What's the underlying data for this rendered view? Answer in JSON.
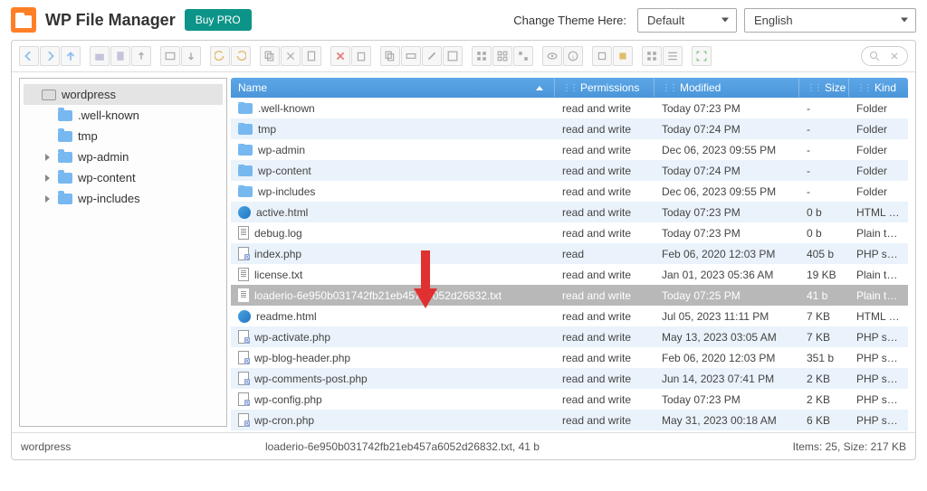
{
  "header": {
    "title": "WP File Manager",
    "buy_pro": "Buy PRO",
    "theme_label": "Change Theme Here:",
    "theme_value": "Default",
    "lang_value": "English"
  },
  "tree": {
    "root": "wordpress",
    "items": [
      {
        "label": ".well-known",
        "expandable": false
      },
      {
        "label": "tmp",
        "expandable": false
      },
      {
        "label": "wp-admin",
        "expandable": true
      },
      {
        "label": "wp-content",
        "expandable": true
      },
      {
        "label": "wp-includes",
        "expandable": true
      }
    ]
  },
  "columns": {
    "name": "Name",
    "permissions": "Permissions",
    "modified": "Modified",
    "size": "Size",
    "kind": "Kind"
  },
  "files": [
    {
      "name": ".well-known",
      "type": "folder",
      "perm": "read and write",
      "mod": "Today 07:23 PM",
      "size": "-",
      "kind": "Folder",
      "selected": false
    },
    {
      "name": "tmp",
      "type": "folder",
      "perm": "read and write",
      "mod": "Today 07:24 PM",
      "size": "-",
      "kind": "Folder",
      "selected": false
    },
    {
      "name": "wp-admin",
      "type": "folder",
      "perm": "read and write",
      "mod": "Dec 06, 2023 09:55 PM",
      "size": "-",
      "kind": "Folder",
      "selected": false
    },
    {
      "name": "wp-content",
      "type": "folder",
      "perm": "read and write",
      "mod": "Today 07:24 PM",
      "size": "-",
      "kind": "Folder",
      "selected": false
    },
    {
      "name": "wp-includes",
      "type": "folder",
      "perm": "read and write",
      "mod": "Dec 06, 2023 09:55 PM",
      "size": "-",
      "kind": "Folder",
      "selected": false
    },
    {
      "name": "active.html",
      "type": "html",
      "perm": "read and write",
      "mod": "Today 07:23 PM",
      "size": "0 b",
      "kind": "HTML doc",
      "selected": false
    },
    {
      "name": "debug.log",
      "type": "txt",
      "perm": "read and write",
      "mod": "Today 07:23 PM",
      "size": "0 b",
      "kind": "Plain text",
      "selected": false
    },
    {
      "name": "index.php",
      "type": "php",
      "perm": "read",
      "mod": "Feb 06, 2020 12:03 PM",
      "size": "405 b",
      "kind": "PHP sour",
      "selected": false
    },
    {
      "name": "license.txt",
      "type": "txt",
      "perm": "read and write",
      "mod": "Jan 01, 2023 05:36 AM",
      "size": "19 KB",
      "kind": "Plain text",
      "selected": false
    },
    {
      "name": "loaderio-6e950b031742fb21eb457a6052d26832.txt",
      "type": "txt",
      "perm": "read and write",
      "mod": "Today 07:25 PM",
      "size": "41 b",
      "kind": "Plain text",
      "selected": true
    },
    {
      "name": "readme.html",
      "type": "html",
      "perm": "read and write",
      "mod": "Jul 05, 2023 11:11 PM",
      "size": "7 KB",
      "kind": "HTML doc",
      "selected": false
    },
    {
      "name": "wp-activate.php",
      "type": "php",
      "perm": "read and write",
      "mod": "May 13, 2023 03:05 AM",
      "size": "7 KB",
      "kind": "PHP sour",
      "selected": false
    },
    {
      "name": "wp-blog-header.php",
      "type": "php",
      "perm": "read and write",
      "mod": "Feb 06, 2020 12:03 PM",
      "size": "351 b",
      "kind": "PHP sour",
      "selected": false
    },
    {
      "name": "wp-comments-post.php",
      "type": "php",
      "perm": "read and write",
      "mod": "Jun 14, 2023 07:41 PM",
      "size": "2 KB",
      "kind": "PHP sour",
      "selected": false
    },
    {
      "name": "wp-config.php",
      "type": "php",
      "perm": "read and write",
      "mod": "Today 07:23 PM",
      "size": "2 KB",
      "kind": "PHP sour",
      "selected": false
    },
    {
      "name": "wp-cron.php",
      "type": "php",
      "perm": "read and write",
      "mod": "May 31, 2023 00:18 AM",
      "size": "6 KB",
      "kind": "PHP sour",
      "selected": false
    }
  ],
  "statusbar": {
    "path": "wordpress",
    "selection": "loaderio-6e950b031742fb21eb457a6052d26832.txt, 41 b",
    "summary": "Items: 25, Size: 217 KB"
  }
}
